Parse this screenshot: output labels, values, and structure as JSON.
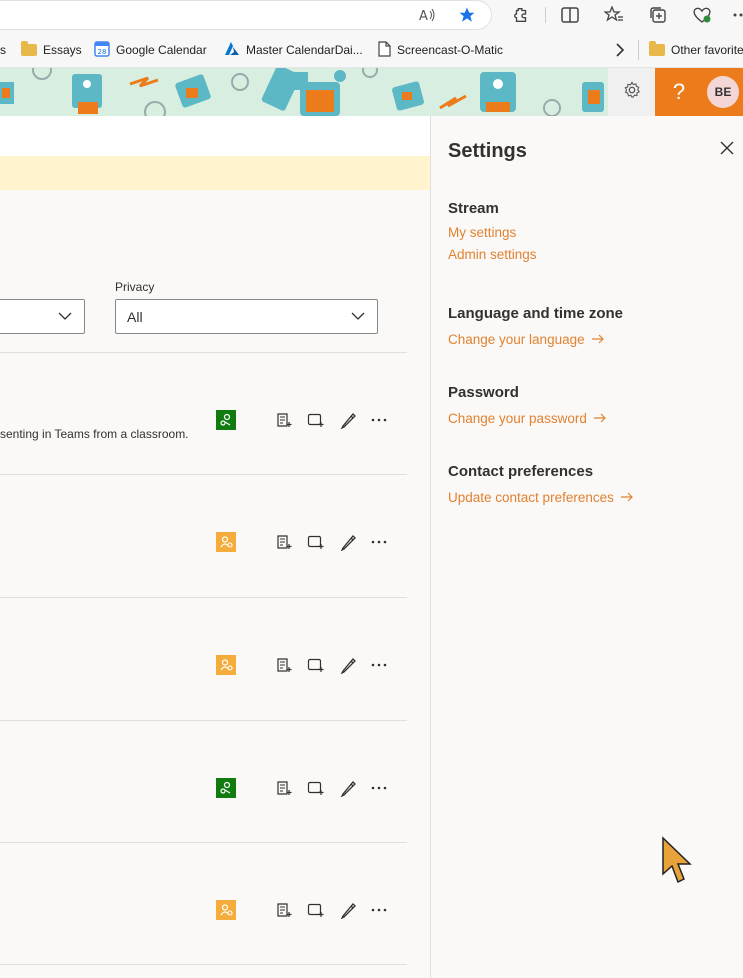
{
  "bookmarks": {
    "items": [
      {
        "label": "Essays",
        "icon": "folder-icon"
      },
      {
        "label": "Google Calendar",
        "icon": "google-calendar-icon"
      },
      {
        "label": "Master CalendarDai...",
        "icon": "azure-icon"
      },
      {
        "label": "Screencast-O-Matic",
        "icon": "page-icon"
      },
      {
        "label": "Other favorites",
        "icon": "folder-icon"
      }
    ],
    "partial_first": "s"
  },
  "header": {
    "avatar_initials": "BE",
    "help_glyph": "?",
    "accent": "#ec7b1b"
  },
  "filters": {
    "privacy_label": "Privacy",
    "privacy_value": "All"
  },
  "list": {
    "rows": [
      {
        "description": "senting in Teams from a classroom.",
        "badge": "green"
      },
      {
        "description": "",
        "badge": "orange"
      },
      {
        "description": "",
        "badge": "orange"
      },
      {
        "description": "",
        "badge": "green"
      },
      {
        "description": "",
        "badge": "orange"
      }
    ]
  },
  "settings": {
    "title": "Settings",
    "stream_heading": "Stream",
    "my_settings": "My settings",
    "admin_settings": "Admin settings",
    "language_heading": "Language and time zone",
    "change_language": "Change your language",
    "password_heading": "Password",
    "change_password": "Change your password",
    "contact_heading": "Contact preferences",
    "update_contact": "Update contact preferences",
    "link_color": "#e1822f"
  }
}
